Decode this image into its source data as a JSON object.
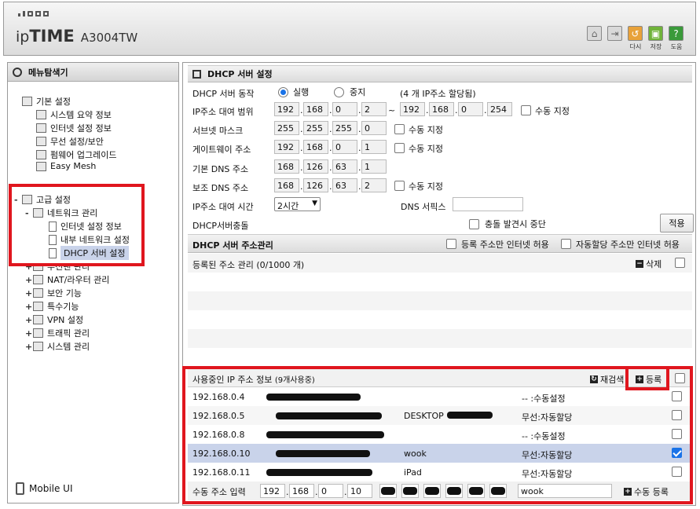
{
  "header": {
    "logo_ip": "ip",
    "logo_time": "TIME",
    "model": "A3004TW",
    "icons": [
      {
        "name": "home-icon",
        "label": "",
        "color": "#d9d9d9"
      },
      {
        "name": "logout-icon",
        "label": "",
        "color": "#d9d9d9"
      },
      {
        "name": "restart-icon",
        "label": "다시",
        "color": "#e8a23a"
      },
      {
        "name": "save-icon",
        "label": "저장",
        "color": "#6fb33a"
      },
      {
        "name": "help-icon",
        "label": "도움",
        "color": "#3a9a3a"
      }
    ]
  },
  "sidebar": {
    "title": "메뉴탐색기",
    "basic": {
      "label": "기본 설정",
      "items": [
        "시스템 요약 정보",
        "인터넷 설정 정보",
        "무선 설정/보안",
        "펌웨어 업그레이드",
        "Easy Mesh"
      ]
    },
    "advanced": {
      "label": "고급 설정",
      "network": "네트워크 관리",
      "network_items": [
        "인터넷 설정 정보",
        "내부 네트워크 설정",
        "DHCP 서버 설정"
      ],
      "wireless": "무선랜 관리",
      "groups": [
        "NAT/라우터 관리",
        "보안 기능",
        "특수기능",
        "VPN 설정",
        "트래픽 관리",
        "시스템 관리"
      ]
    },
    "mobile_ui": "Mobile UI"
  },
  "dhcp": {
    "title": "DHCP 서버 설정",
    "operation_label": "DHCP 서버 동작",
    "run_label": "실행",
    "stop_label": "중지",
    "status_text": "(4 개 IP주소 할당됨)",
    "range_label": "IP주소 대여 범위",
    "range_start": [
      "192",
      "168",
      "0",
      "2"
    ],
    "range_tilde": "~",
    "range_end": [
      "192",
      "168",
      "0",
      "254"
    ],
    "manual_label": "수동 지정",
    "subnet_label": "서브넷 마스크",
    "subnet": [
      "255",
      "255",
      "255",
      "0"
    ],
    "gateway_label": "게이트웨이 주소",
    "gateway": [
      "192",
      "168",
      "0",
      "1"
    ],
    "dns1_label": "기본 DNS 주소",
    "dns1": [
      "168",
      "126",
      "63",
      "1"
    ],
    "dns2_label": "보조 DNS 주소",
    "dns2": [
      "168",
      "126",
      "63",
      "2"
    ],
    "lease_label": "IP주소 대여 시간",
    "lease_value": "2시간",
    "dns_suffix_label": "DNS 서픽스",
    "dns_suffix_value": "",
    "conflict_label": "DHCP서버충돌",
    "conflict_stop_label": "충돌 발견시 중단",
    "apply_label": "적용"
  },
  "address_mgmt": {
    "title": "DHCP 서버 주소관리",
    "only_registered_label": "등록 주소만 인터넷 허용",
    "only_auto_label": "자동할당 주소만 인터넷 허용",
    "registered_label": "등록된 주소 관리 (0/1000 개)",
    "delete_label": "삭제"
  },
  "in_use": {
    "title": "사용중인 IP 주소 정보",
    "count_text": "(9개사용중)",
    "rescan_label": "재검색",
    "register_label": "등록",
    "rows": [
      {
        "ip": "192.168.0.4",
        "name": "",
        "type": "-- :수동설정",
        "checked": false
      },
      {
        "ip": "192.168.0.5",
        "name": "DESKTOP",
        "type": "무선:자동할당",
        "checked": false
      },
      {
        "ip": "192.168.0.8",
        "name": "",
        "type": "-- :수동설정",
        "checked": false
      },
      {
        "ip": "192.168.0.10",
        "name": "wook",
        "type": "무선:자동할당",
        "checked": true
      },
      {
        "ip": "192.168.0.11",
        "name": "iPad",
        "type": "무선:자동할당",
        "checked": false
      }
    ],
    "manual_input_label": "수동 주소 입력",
    "manual_ip": [
      "192",
      "168",
      "0",
      "10"
    ],
    "manual_name": "wook",
    "manual_register_label": "수동 등록"
  }
}
